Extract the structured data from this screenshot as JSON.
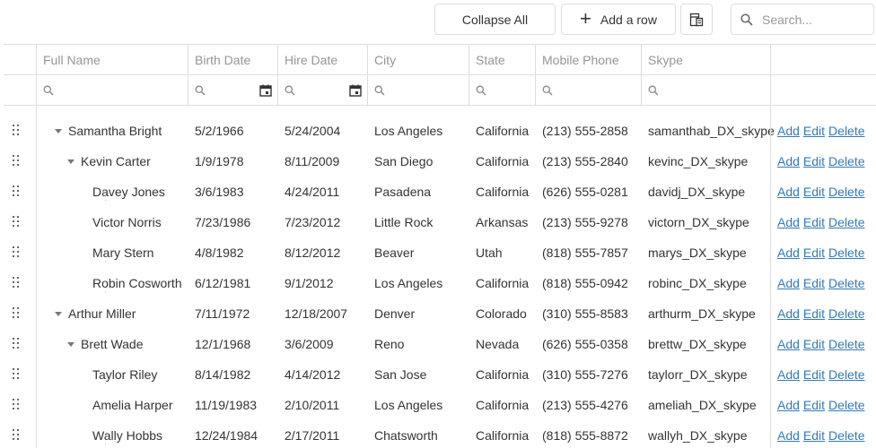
{
  "toolbar": {
    "collapse_all": "Collapse All",
    "add_row": "Add a row",
    "add_icon": "plus-icon",
    "column_chooser_icon": "column-chooser-icon",
    "search_placeholder": "Search..."
  },
  "columns": [
    {
      "label": "Full Name"
    },
    {
      "label": "Birth Date"
    },
    {
      "label": "Hire Date"
    },
    {
      "label": "City"
    },
    {
      "label": "State"
    },
    {
      "label": "Mobile Phone"
    },
    {
      "label": "Skype"
    }
  ],
  "actions": {
    "add": "Add",
    "edit": "Edit",
    "delete": "Delete"
  },
  "rows": [
    {
      "name": "Samantha Bright",
      "level": 1,
      "expander": true,
      "birth": "5/2/1966",
      "hire": "5/24/2004",
      "city": "Los Angeles",
      "state": "California",
      "phone": "(213) 555-2858",
      "skype": "samanthab_DX_skype"
    },
    {
      "name": "Kevin Carter",
      "level": 2,
      "expander": true,
      "birth": "1/9/1978",
      "hire": "8/11/2009",
      "city": "San Diego",
      "state": "California",
      "phone": "(213) 555-2840",
      "skype": "kevinc_DX_skype"
    },
    {
      "name": "Davey Jones",
      "level": 3,
      "expander": false,
      "birth": "3/6/1983",
      "hire": "4/24/2011",
      "city": "Pasadena",
      "state": "California",
      "phone": "(626) 555-0281",
      "skype": "davidj_DX_skype"
    },
    {
      "name": "Victor Norris",
      "level": 3,
      "expander": false,
      "birth": "7/23/1986",
      "hire": "7/23/2012",
      "city": "Little Rock",
      "state": "Arkansas",
      "phone": "(213) 555-9278",
      "skype": "victorn_DX_skype"
    },
    {
      "name": "Mary Stern",
      "level": 3,
      "expander": false,
      "birth": "4/8/1982",
      "hire": "8/12/2012",
      "city": "Beaver",
      "state": "Utah",
      "phone": "(818) 555-7857",
      "skype": "marys_DX_skype"
    },
    {
      "name": "Robin Cosworth",
      "level": 3,
      "expander": false,
      "birth": "6/12/1981",
      "hire": "9/1/2012",
      "city": "Los Angeles",
      "state": "California",
      "phone": "(818) 555-0942",
      "skype": "robinc_DX_skype"
    },
    {
      "name": "Arthur Miller",
      "level": 1,
      "expander": true,
      "birth": "7/11/1972",
      "hire": "12/18/2007",
      "city": "Denver",
      "state": "Colorado",
      "phone": "(310) 555-8583",
      "skype": "arthurm_DX_skype"
    },
    {
      "name": "Brett Wade",
      "level": 2,
      "expander": true,
      "birth": "12/1/1968",
      "hire": "3/6/2009",
      "city": "Reno",
      "state": "Nevada",
      "phone": "(626) 555-0358",
      "skype": "brettw_DX_skype"
    },
    {
      "name": "Taylor Riley",
      "level": 3,
      "expander": false,
      "birth": "8/14/1982",
      "hire": "4/14/2012",
      "city": "San Jose",
      "state": "California",
      "phone": "(310) 555-7276",
      "skype": "taylorr_DX_skype"
    },
    {
      "name": "Amelia Harper",
      "level": 3,
      "expander": false,
      "birth": "11/19/1983",
      "hire": "2/10/2011",
      "city": "Los Angeles",
      "state": "California",
      "phone": "(213) 555-4276",
      "skype": "ameliah_DX_skype"
    },
    {
      "name": "Wally Hobbs",
      "level": 3,
      "expander": false,
      "birth": "12/24/1984",
      "hire": "2/17/2011",
      "city": "Chatsworth",
      "state": "California",
      "phone": "(818) 555-8872",
      "skype": "wallyh_DX_skype"
    }
  ]
}
